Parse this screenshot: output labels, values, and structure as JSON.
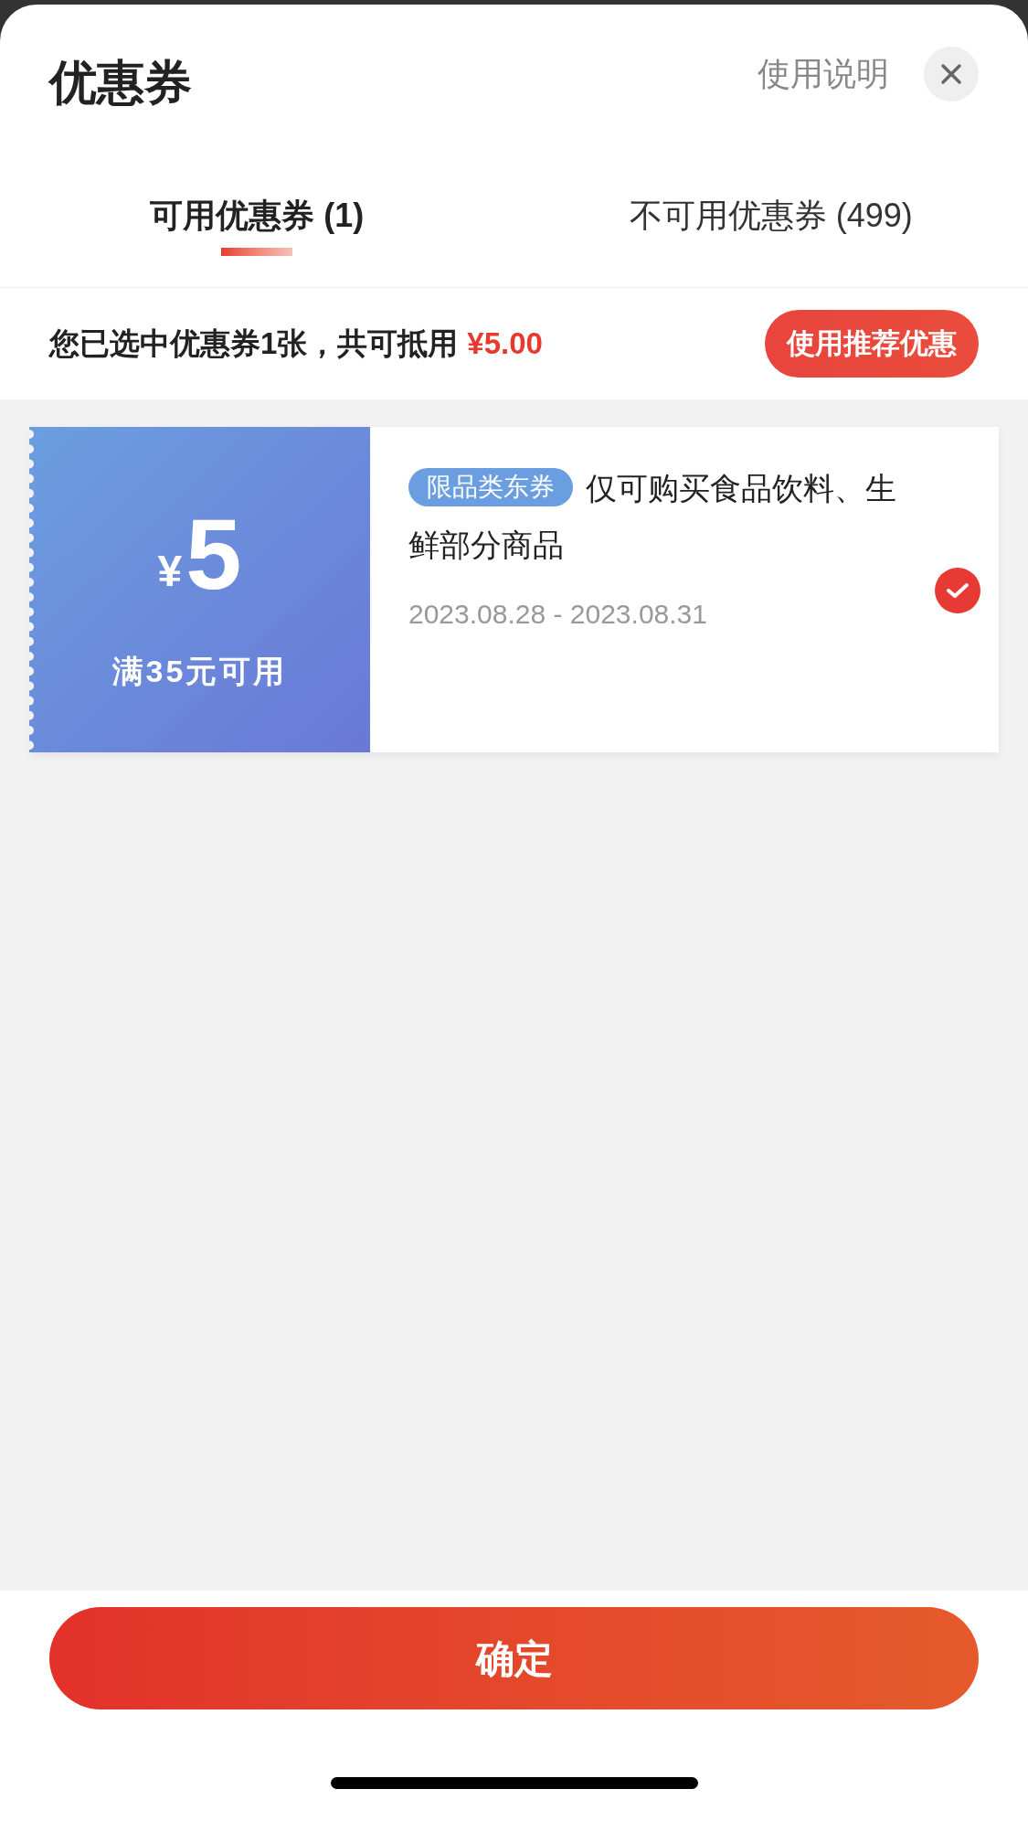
{
  "header": {
    "title": "优惠券",
    "help_link": "使用说明"
  },
  "tabs": [
    {
      "label": "可用优惠券 (1)",
      "selected": true
    },
    {
      "label": "不可用优惠券 (499)",
      "selected": false
    }
  ],
  "summary": {
    "text": "您已选中优惠券1张，共可抵用",
    "amount": "¥5.00",
    "button": "使用推荐优惠"
  },
  "coupons": [
    {
      "currency": "¥",
      "amount": "5",
      "condition": "满35元可用",
      "tag": "限品类东券",
      "description": "仅可购买食品饮料、生鲜部分商品",
      "validity": "2023.08.28 - 2023.08.31",
      "selected": true
    }
  ],
  "confirm_button": "确定"
}
